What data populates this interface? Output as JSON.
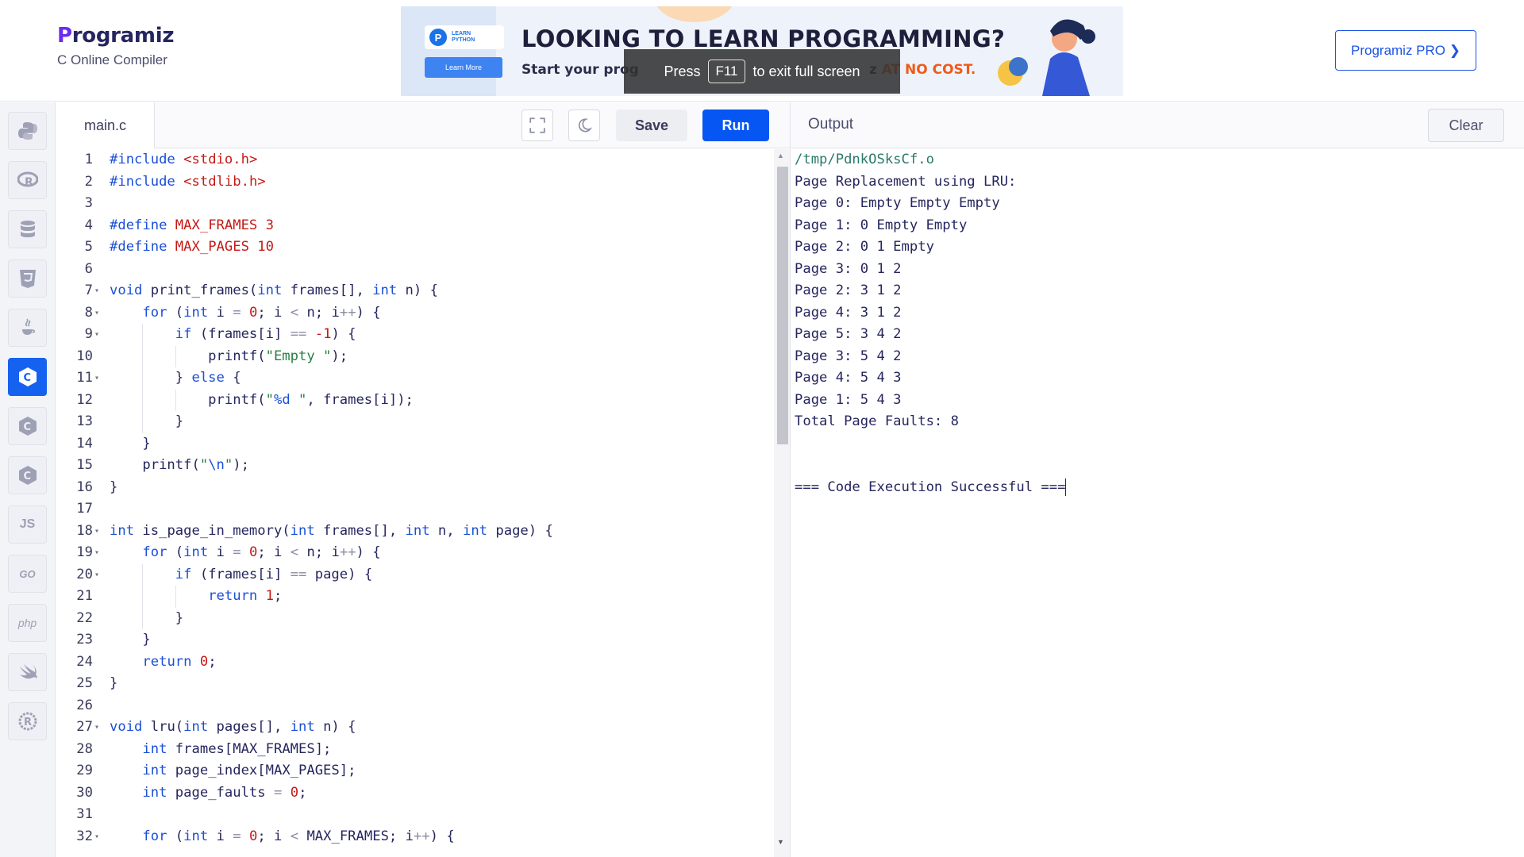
{
  "header": {
    "logo_text": "rogramiz",
    "logo_letter": "P",
    "subtitle": "C Online Compiler",
    "pro_button": "Programiz PRO ❯"
  },
  "ad": {
    "badge_top": "LEARN",
    "badge_bottom": "PYTHON",
    "learn_more": "Learn More",
    "title": "LOOKING TO LEARN PROGRAMMING?",
    "subtitle_start": "Start your prog",
    "subtitle_mid": "z",
    "subtitle_accent_1": "AT",
    "subtitle_accent_2": "NO COST."
  },
  "fullscreen_toast": {
    "press": "Press",
    "key": "F11",
    "rest": "to exit full screen"
  },
  "sidebar": {
    "languages": [
      "python",
      "r",
      "sql",
      "html",
      "java",
      "c",
      "cpp",
      "csharp",
      "js",
      "go",
      "php",
      "swift",
      "rust"
    ],
    "active": "c",
    "labels": {
      "js": "JS",
      "go": "GO",
      "php": "php"
    }
  },
  "editor": {
    "file_tab": "main.c",
    "save_label": "Save",
    "run_label": "Run",
    "lines": [
      [
        [
          "pp",
          "#include"
        ],
        [
          "t",
          " "
        ],
        [
          "inc",
          "<stdio.h>"
        ]
      ],
      [
        [
          "pp",
          "#include"
        ],
        [
          "t",
          " "
        ],
        [
          "inc",
          "<stdlib.h>"
        ]
      ],
      [],
      [
        [
          "pp",
          "#define"
        ],
        [
          "t",
          " "
        ],
        [
          "inc",
          "MAX_FRAMES"
        ],
        [
          "t",
          " "
        ],
        [
          "num",
          "3"
        ]
      ],
      [
        [
          "pp",
          "#define"
        ],
        [
          "t",
          " "
        ],
        [
          "inc",
          "MAX_PAGES"
        ],
        [
          "t",
          " "
        ],
        [
          "num",
          "10"
        ]
      ],
      [],
      [
        [
          "kw",
          "void"
        ],
        [
          "t",
          " print_frames("
        ],
        [
          "kw",
          "int"
        ],
        [
          "t",
          " frames[], "
        ],
        [
          "kw",
          "int"
        ],
        [
          "t",
          " n) {"
        ]
      ],
      [
        [
          "t",
          "    "
        ],
        [
          "kw",
          "for"
        ],
        [
          "t",
          " ("
        ],
        [
          "kw",
          "int"
        ],
        [
          "t",
          " i "
        ],
        [
          "op",
          "="
        ],
        [
          "t",
          " "
        ],
        [
          "num",
          "0"
        ],
        [
          "t",
          "; i "
        ],
        [
          "op",
          "<"
        ],
        [
          "t",
          " n; i"
        ],
        [
          "op",
          "++"
        ],
        [
          "t",
          ") {"
        ]
      ],
      [
        [
          "t",
          "        "
        ],
        [
          "kw",
          "if"
        ],
        [
          "t",
          " (frames[i] "
        ],
        [
          "op",
          "=="
        ],
        [
          "t",
          " "
        ],
        [
          "num",
          "-1"
        ],
        [
          "t",
          ") {"
        ]
      ],
      [
        [
          "t",
          "            printf("
        ],
        [
          "str",
          "\"Empty \""
        ],
        [
          "t",
          ");"
        ]
      ],
      [
        [
          "t",
          "        } "
        ],
        [
          "kw",
          "else"
        ],
        [
          "t",
          " {"
        ]
      ],
      [
        [
          "t",
          "            printf("
        ],
        [
          "str",
          "\""
        ],
        [
          "esc",
          "%d"
        ],
        [
          "str",
          " \""
        ],
        [
          "t",
          ", frames[i]);"
        ]
      ],
      [
        [
          "t",
          "        }"
        ]
      ],
      [
        [
          "t",
          "    }"
        ]
      ],
      [
        [
          "t",
          "    printf("
        ],
        [
          "str",
          "\""
        ],
        [
          "esc",
          "\\n"
        ],
        [
          "str",
          "\""
        ],
        [
          "t",
          ");"
        ]
      ],
      [
        [
          "t",
          "}"
        ]
      ],
      [],
      [
        [
          "kw",
          "int"
        ],
        [
          "t",
          " is_page_in_memory("
        ],
        [
          "kw",
          "int"
        ],
        [
          "t",
          " frames[], "
        ],
        [
          "kw",
          "int"
        ],
        [
          "t",
          " n, "
        ],
        [
          "kw",
          "int"
        ],
        [
          "t",
          " page) {"
        ]
      ],
      [
        [
          "t",
          "    "
        ],
        [
          "kw",
          "for"
        ],
        [
          "t",
          " ("
        ],
        [
          "kw",
          "int"
        ],
        [
          "t",
          " i "
        ],
        [
          "op",
          "="
        ],
        [
          "t",
          " "
        ],
        [
          "num",
          "0"
        ],
        [
          "t",
          "; i "
        ],
        [
          "op",
          "<"
        ],
        [
          "t",
          " n; i"
        ],
        [
          "op",
          "++"
        ],
        [
          "t",
          ") {"
        ]
      ],
      [
        [
          "t",
          "        "
        ],
        [
          "kw",
          "if"
        ],
        [
          "t",
          " (frames[i] "
        ],
        [
          "op",
          "=="
        ],
        [
          "t",
          " page) {"
        ]
      ],
      [
        [
          "t",
          "            "
        ],
        [
          "kw",
          "return"
        ],
        [
          "t",
          " "
        ],
        [
          "num",
          "1"
        ],
        [
          "t",
          ";"
        ]
      ],
      [
        [
          "t",
          "        }"
        ]
      ],
      [
        [
          "t",
          "    }"
        ]
      ],
      [
        [
          "t",
          "    "
        ],
        [
          "kw",
          "return"
        ],
        [
          "t",
          " "
        ],
        [
          "num",
          "0"
        ],
        [
          "t",
          ";"
        ]
      ],
      [
        [
          "t",
          "}"
        ]
      ],
      [],
      [
        [
          "kw",
          "void"
        ],
        [
          "t",
          " lru("
        ],
        [
          "kw",
          "int"
        ],
        [
          "t",
          " pages[], "
        ],
        [
          "kw",
          "int"
        ],
        [
          "t",
          " n) {"
        ]
      ],
      [
        [
          "t",
          "    "
        ],
        [
          "kw",
          "int"
        ],
        [
          "t",
          " frames[MAX_FRAMES];"
        ]
      ],
      [
        [
          "t",
          "    "
        ],
        [
          "kw",
          "int"
        ],
        [
          "t",
          " page_index[MAX_PAGES];"
        ]
      ],
      [
        [
          "t",
          "    "
        ],
        [
          "kw",
          "int"
        ],
        [
          "t",
          " page_faults "
        ],
        [
          "op",
          "="
        ],
        [
          "t",
          " "
        ],
        [
          "num",
          "0"
        ],
        [
          "t",
          ";"
        ]
      ],
      [],
      [
        [
          "t",
          "    "
        ],
        [
          "kw",
          "for"
        ],
        [
          "t",
          " ("
        ],
        [
          "kw",
          "int"
        ],
        [
          "t",
          " i "
        ],
        [
          "op",
          "="
        ],
        [
          "t",
          " "
        ],
        [
          "num",
          "0"
        ],
        [
          "t",
          "; i "
        ],
        [
          "op",
          "<"
        ],
        [
          "t",
          " MAX_FRAMES; i"
        ],
        [
          "op",
          "++"
        ],
        [
          "t",
          ") {"
        ]
      ]
    ],
    "fold_lines": [
      7,
      8,
      9,
      11,
      18,
      19,
      20,
      27,
      32
    ]
  },
  "output": {
    "title": "Output",
    "clear_label": "Clear",
    "lines": [
      "/tmp/PdnkOSksCf.o",
      "Page Replacement using LRU:",
      "Page 0: Empty Empty Empty",
      "Page 1: 0 Empty Empty",
      "Page 2: 0 1 Empty",
      "Page 3: 0 1 2",
      "Page 2: 3 1 2",
      "Page 4: 3 1 2",
      "Page 5: 3 4 2",
      "Page 3: 5 4 2",
      "Page 4: 5 4 3",
      "Page 1: 5 4 3",
      "Total Page Faults: 8",
      "",
      "",
      "=== Code Execution Successful ==="
    ]
  }
}
